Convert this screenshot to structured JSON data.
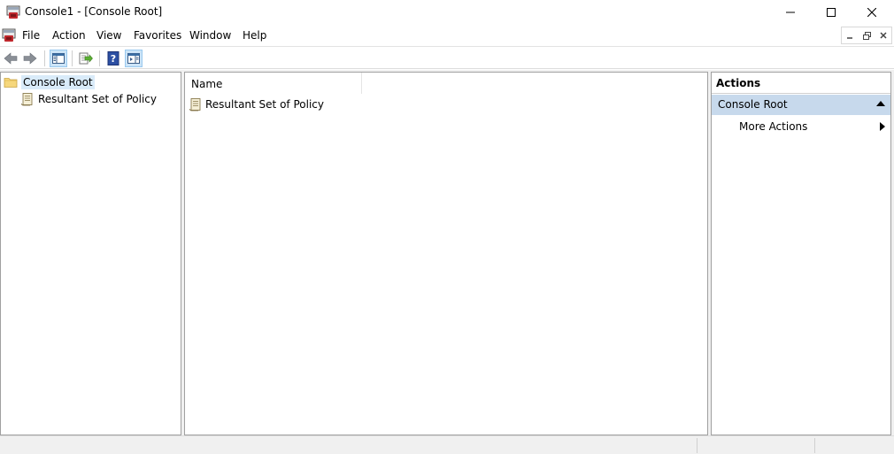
{
  "window": {
    "title": "Console1 - [Console Root]"
  },
  "menu": {
    "items": [
      "File",
      "Action",
      "View",
      "Favorites",
      "Window",
      "Help"
    ]
  },
  "toolbar": {
    "buttons": [
      "back-icon",
      "forward-icon",
      "show-hide-console-tree-icon",
      "export-list-icon",
      "help-icon",
      "show-hide-action-pane-icon"
    ]
  },
  "tree": {
    "root": "Console Root",
    "children": [
      "Resultant Set of Policy"
    ]
  },
  "list": {
    "column_name": "Name",
    "rows": [
      "Resultant Set of Policy"
    ]
  },
  "actions": {
    "header": "Actions",
    "section": "Console Root",
    "items": [
      "More Actions"
    ]
  },
  "colors": {
    "selection": "#d9ebf9",
    "actions_section_bg": "#c7d9ec",
    "pane_border": "#a0a0a0"
  }
}
